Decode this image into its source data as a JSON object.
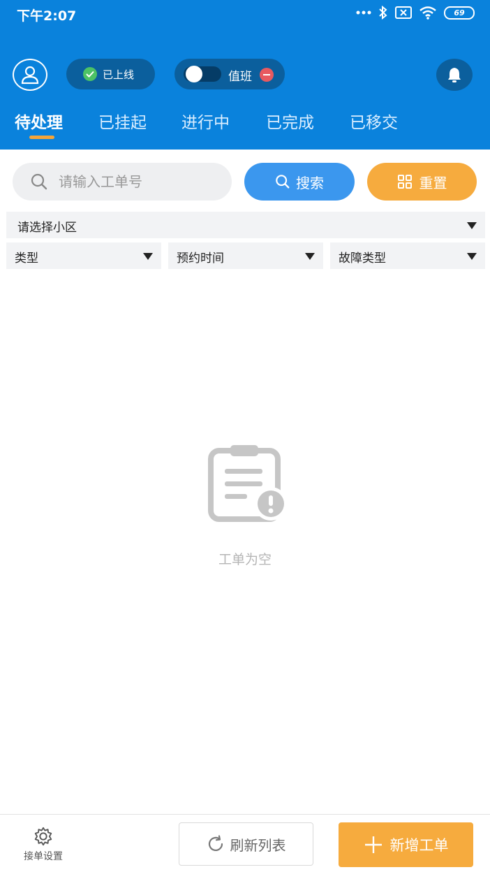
{
  "status_bar": {
    "time": "下午2:07",
    "battery": "69"
  },
  "header": {
    "online_label": "已上线",
    "duty_label": "值班",
    "tabs": [
      {
        "label": "待处理",
        "active": true
      },
      {
        "label": "已挂起",
        "active": false
      },
      {
        "label": "进行中",
        "active": false
      },
      {
        "label": "已完成",
        "active": false
      },
      {
        "label": "已移交",
        "active": false
      }
    ]
  },
  "search": {
    "placeholder": "请输入工单号",
    "search_label": "搜索",
    "reset_label": "重置"
  },
  "filters": {
    "community": "请选择小区",
    "type": "类型",
    "appointment_time": "预约时间",
    "fault_type": "故障类型"
  },
  "empty_state": {
    "text": "工单为空"
  },
  "footer": {
    "settings_label": "接单设置",
    "refresh_label": "刷新列表",
    "add_label": "新增工单"
  },
  "colors": {
    "header_bg": "#0a82dc",
    "search_button": "#3b97ee",
    "accent_orange": "#f6ab3e",
    "online_green": "#4cc265",
    "duty_red": "#e85a60"
  }
}
